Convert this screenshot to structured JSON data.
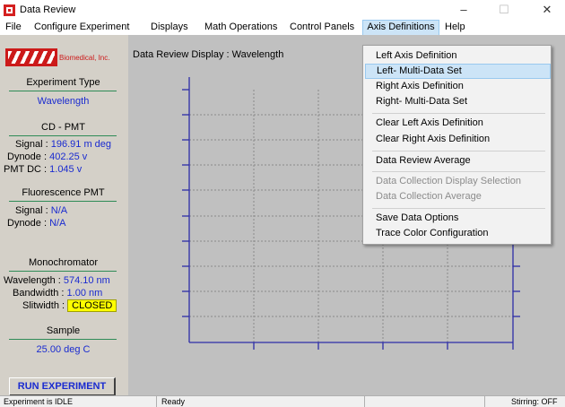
{
  "window": {
    "title": "Data Review",
    "minimize": "–",
    "maximize": "☐",
    "close": "✕"
  },
  "menu": [
    "File",
    "Configure Experiment",
    "Displays",
    "Math Operations",
    "Control Panels",
    "Axis Definitions",
    "Help"
  ],
  "logo": {
    "text": "Biomedical, Inc."
  },
  "left_panel": {
    "experiment_type": {
      "title": "Experiment Type",
      "value": "Wavelength"
    },
    "cd_pmt": {
      "title": "CD - PMT",
      "signal_label": "Signal :",
      "signal_value": "196.91 m deg",
      "dynode_label": "Dynode :",
      "dynode_value": "402.25 v",
      "pmtdc_label": "PMT DC :",
      "pmtdc_value": "1.045 v"
    },
    "fluorescence": {
      "title": "Fluorescence PMT",
      "signal_label": "Signal :",
      "signal_value": "N/A",
      "dynode_label": "Dynode :",
      "dynode_value": "N/A"
    },
    "monochromator": {
      "title": "Monochromator",
      "wavelength_label": "Wavelength :",
      "wavelength_value": "574.10 nm",
      "bandwidth_label": "Bandwidth :",
      "bandwidth_value": "1.00 nm",
      "slitwidth_label": "Slitwidth :",
      "slitwidth_value": "CLOSED"
    },
    "sample": {
      "title": "Sample",
      "value": "25.00 deg C"
    },
    "run_button": "RUN  EXPERIMENT"
  },
  "display": {
    "title": "Data Review Display : Wavelength"
  },
  "dropdown": {
    "items": [
      {
        "label": "Left Axis Definition",
        "state": "normal"
      },
      {
        "label": "Left- Multi-Data Set",
        "state": "highlight"
      },
      {
        "label": "Right Axis Definition",
        "state": "normal"
      },
      {
        "label": "Right- Multi-Data Set",
        "state": "normal"
      },
      {
        "label": "Clear Left Axis Definition",
        "state": "normal"
      },
      {
        "label": "Clear Right Axis Definition",
        "state": "normal"
      },
      {
        "label": "Data Review Average",
        "state": "normal"
      },
      {
        "label": "Data Collection Display Selection",
        "state": "disabled"
      },
      {
        "label": "Data Collection Average",
        "state": "disabled"
      },
      {
        "label": "Save Data Options",
        "state": "normal"
      },
      {
        "label": "Trace Color Configuration",
        "state": "normal"
      }
    ]
  },
  "status": {
    "experiment": "Experiment is IDLE",
    "state": "Ready",
    "stirring": "Stirring: OFF"
  },
  "colors": {
    "accent_blue": "#1a2bd0",
    "axis_blue": "#2c2ca8",
    "logo_red": "#cc1a1a",
    "badge_yellow": "#ffff00",
    "section_line": "#2e8b57"
  }
}
